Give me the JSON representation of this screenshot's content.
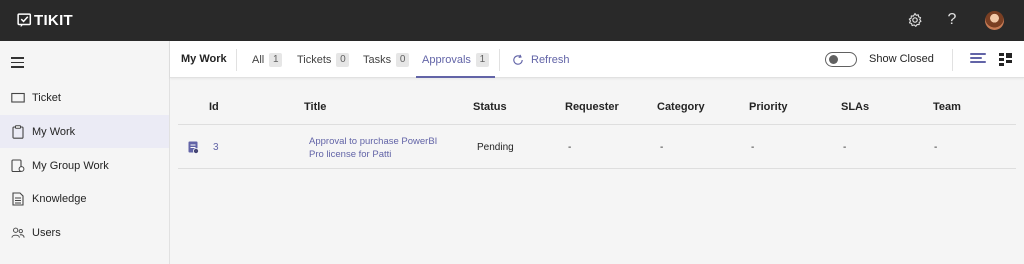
{
  "app": {
    "name": "TIKIT"
  },
  "topbar": {
    "settings_icon": "gear-icon",
    "help_icon": "question-icon",
    "help_glyph": "?"
  },
  "sidebar": {
    "items": [
      {
        "label": "Ticket",
        "icon": "ticket-icon",
        "active": false
      },
      {
        "label": "My Work",
        "icon": "clipboard-icon",
        "active": true
      },
      {
        "label": "My Group Work",
        "icon": "group-work-icon",
        "active": false
      },
      {
        "label": "Knowledge",
        "icon": "document-icon",
        "active": false
      },
      {
        "label": "Users",
        "icon": "users-icon",
        "active": false
      }
    ]
  },
  "toolbar": {
    "title": "My Work",
    "tabs": [
      {
        "label": "All",
        "count": "1",
        "active": false
      },
      {
        "label": "Tickets",
        "count": "0",
        "active": false
      },
      {
        "label": "Tasks",
        "count": "0",
        "active": false
      },
      {
        "label": "Approvals",
        "count": "1",
        "active": true
      }
    ],
    "refresh_label": "Refresh",
    "show_closed_label": "Show Closed",
    "show_closed_on": false
  },
  "table": {
    "columns": [
      "Id",
      "Title",
      "Status",
      "Requester",
      "Category",
      "Priority",
      "SLAs",
      "Team"
    ],
    "rows": [
      {
        "id": "3",
        "title": "Approval to purchase PowerBI Pro license for Patti",
        "status": "Pending",
        "requester": "-",
        "category": "-",
        "priority": "-",
        "slas": "-",
        "team": "-"
      }
    ]
  },
  "colors": {
    "accent": "#6264a7",
    "topbar": "#292929"
  }
}
